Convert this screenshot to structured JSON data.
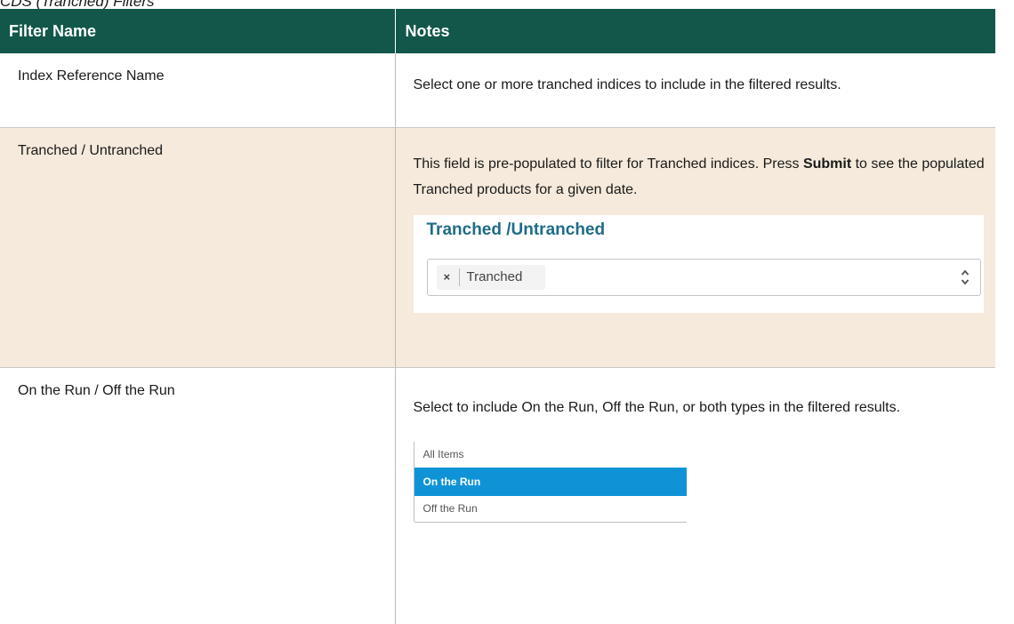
{
  "caption": "CDS (Tranched) Filters",
  "table": {
    "headers": [
      "Filter Name",
      "Notes"
    ],
    "rows": [
      {
        "name": "Index Reference Name",
        "note": "Select one or more tranched indices to include in the filtered results."
      },
      {
        "name": "Tranched / Untranched",
        "note_before": "This field is pre-populated to filter for Tranched indices. Press ",
        "note_bold": "Submit",
        "note_after": " to see the populated Tranched products for a given date.",
        "widget": {
          "title": "Tranched /Untranched",
          "tag_remove": "×",
          "tag_label": "Tranched",
          "chevron_icon": "up-down-chevron-icon"
        }
      },
      {
        "name": "On the Run / Off the Run",
        "note": "Select to include On the Run, Off the Run, or both types in the filtered results.",
        "options": [
          "All Items",
          "On the Run",
          "Off the Run"
        ],
        "selected_option": "On the Run"
      }
    ]
  },
  "colors": {
    "header_bg": "#12574a",
    "highlight_row_bg": "#f5eadb",
    "widget_title": "#1f6c87",
    "selected_option_bg": "#0f93d6"
  }
}
